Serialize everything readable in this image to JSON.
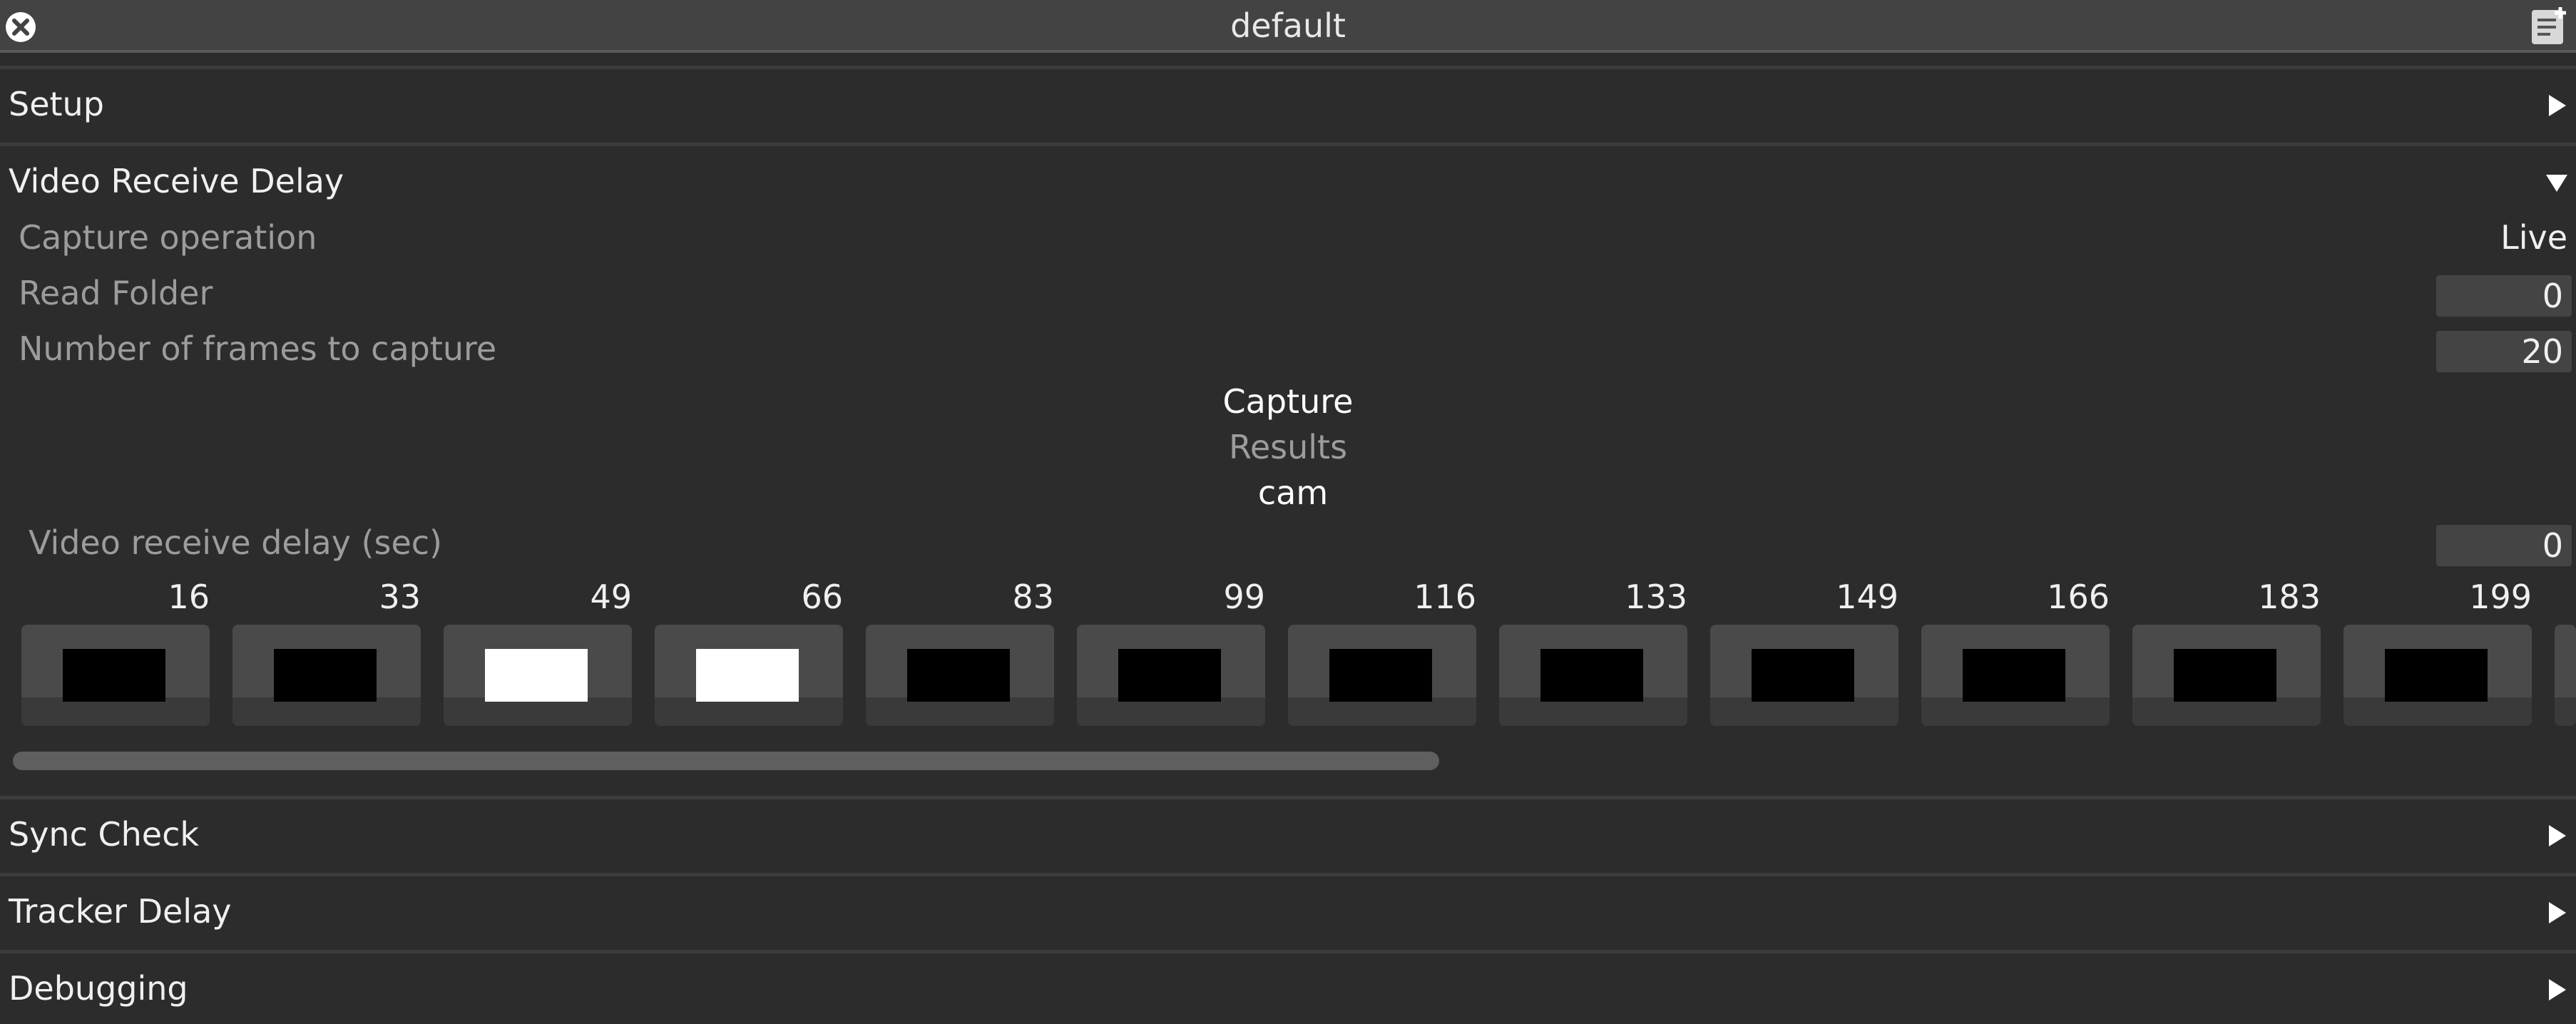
{
  "window": {
    "title": "default"
  },
  "sections": {
    "setup": "Setup",
    "video_receive_delay": "Video Receive Delay",
    "sync_check": "Sync Check",
    "tracker_delay": "Tracker Delay",
    "debugging": "Debugging"
  },
  "video_receive_delay": {
    "capture_operation_label": "Capture operation",
    "capture_operation_value": "Live",
    "read_folder_label": "Read Folder",
    "read_folder_value": "0",
    "frames_label": "Number of frames to capture",
    "frames_value": "20",
    "capture_button": "Capture",
    "results_label": "Results",
    "camera_label": "cam",
    "delay_label": "Video receive delay (sec)",
    "delay_value": "0",
    "frame_numbers": [
      "16",
      "33",
      "49",
      "66",
      "83",
      "99",
      "116",
      "133",
      "149",
      "166",
      "183",
      "199"
    ],
    "frames_white": [
      false,
      false,
      true,
      true,
      false,
      false,
      false,
      false,
      false,
      false,
      false,
      false
    ]
  },
  "colors": {
    "background": "#2c2c2c",
    "titlebar": "#434343",
    "field": "#444444"
  }
}
